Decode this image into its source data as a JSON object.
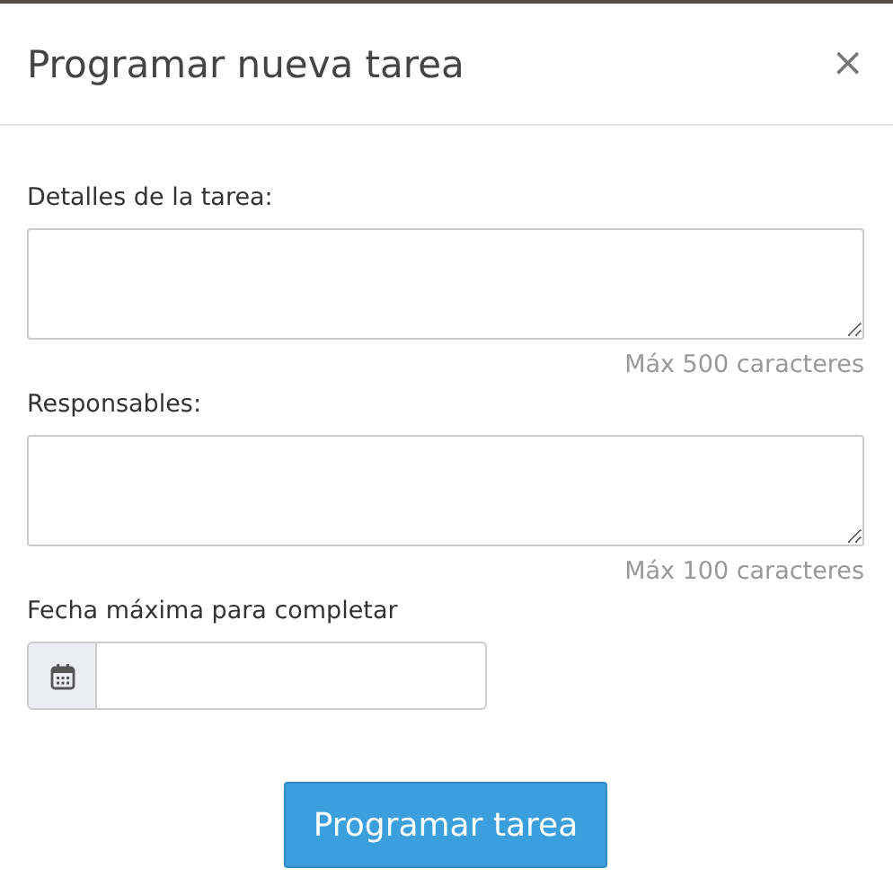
{
  "dialog": {
    "title": "Programar nueva tarea",
    "close": "×"
  },
  "fields": [
    {
      "kind": "textarea",
      "label": "Detalles de la tarea:",
      "hint": "Máx 500 caracteres"
    },
    {
      "kind": "textarea",
      "label": "Responsables:",
      "hint": "Máx 100 caracteres"
    },
    {
      "kind": "date",
      "label": "Fecha máxima para completar"
    }
  ],
  "submit": "Programar tarea"
}
